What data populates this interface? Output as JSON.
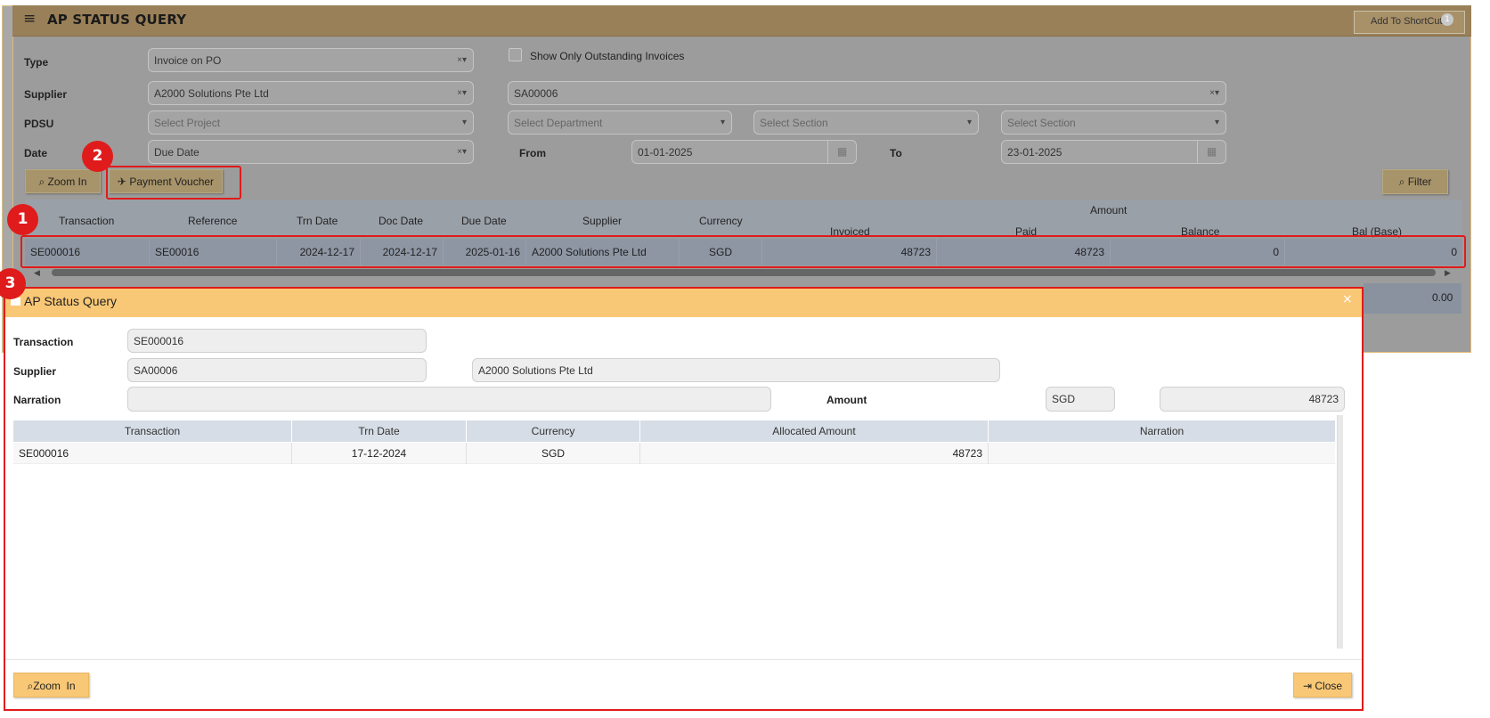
{
  "header": {
    "menu_icon": "hamburger-icon",
    "title": "AP STATUS QUERY",
    "add_shortcut_label": "Add To ShortCut",
    "shortcut_badge": "1"
  },
  "filters": {
    "type_label": "Type",
    "type_value": "Invoice on PO",
    "outstanding_label": "Show Only Outstanding Invoices",
    "outstanding_checked": false,
    "supplier_label": "Supplier",
    "supplier_name": "A2000 Solutions Pte Ltd",
    "supplier_code": "SA00006",
    "pdsu_label": "PDSU",
    "project_placeholder": "Select Project",
    "department_placeholder": "Select Department",
    "section_placeholder_1": "Select Section",
    "section_placeholder_2": "Select Section",
    "date_label": "Date",
    "date_type": "Due Date",
    "from_label": "From",
    "from_value": "01-01-2025",
    "to_label": "To",
    "to_value": "23-01-2025",
    "clear_dropdown_glyph": "×▾",
    "dropdown_glyph": "▾"
  },
  "toolbar": {
    "zoom_in_label": "Zoom In",
    "payment_voucher_label": "Payment Voucher",
    "filter_label": "Filter"
  },
  "grid": {
    "amount_group_label": "Amount",
    "columns": [
      "Transaction",
      "Reference",
      "Trn Date",
      "Doc Date",
      "Due Date",
      "Supplier",
      "Currency",
      "Invoiced",
      "Paid",
      "Balance",
      "Bal (Base)"
    ],
    "rows": [
      [
        "SE000016",
        "SE00016",
        "2024-12-17",
        "2024-12-17",
        "2025-01-16",
        "A2000 Solutions Pte Ltd",
        "SGD",
        "48723",
        "48723",
        "0",
        "0"
      ]
    ],
    "total_value": "0.00"
  },
  "annotations": {
    "badge_1": "1",
    "badge_2": "2",
    "badge_3": "3"
  },
  "modal": {
    "title": "AP Status Query",
    "close_glyph": "×",
    "transaction_label": "Transaction",
    "transaction_value": "SE000016",
    "supplier_label": "Supplier",
    "supplier_code": "SA00006",
    "supplier_name": "A2000 Solutions Pte Ltd",
    "narration_label": "Narration",
    "narration_value": "",
    "amount_label": "Amount",
    "amount_currency": "SGD",
    "amount_value": "48723",
    "grid_columns": [
      "Transaction",
      "Trn Date",
      "Currency",
      "Allocated Amount",
      "Narration"
    ],
    "grid_rows": [
      [
        "SE000016",
        "17-12-2024",
        "SGD",
        "48723",
        ""
      ]
    ],
    "zoom_in_label": "Zoom  In",
    "close_label": "Close"
  },
  "colors": {
    "header_gold": "#9a8058",
    "modal_header": "#f9c876",
    "annotation_red": "#e01b1b",
    "grid_header": "#d6dde6"
  }
}
